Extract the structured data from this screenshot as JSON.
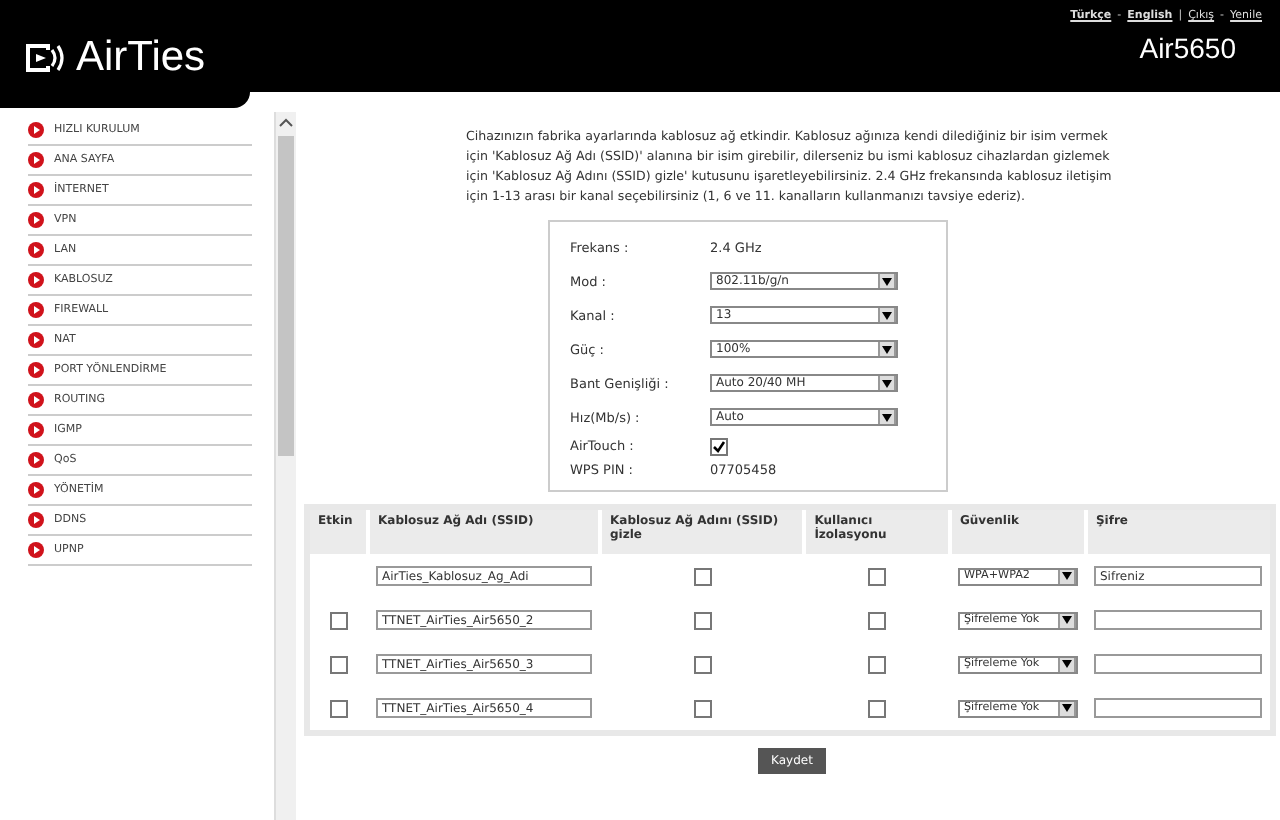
{
  "header": {
    "logo": "AirTies",
    "model": "Air5650",
    "links": [
      {
        "kind": "link",
        "label": "Türkçe",
        "bold": true
      },
      {
        "kind": "sep",
        "label": "-"
      },
      {
        "kind": "link",
        "label": "English",
        "bold": true
      },
      {
        "kind": "sep",
        "label": "|"
      },
      {
        "kind": "link",
        "label": "Çıkış",
        "bold": false
      },
      {
        "kind": "sep",
        "label": "-"
      },
      {
        "kind": "link",
        "label": "Yenile",
        "bold": false
      }
    ]
  },
  "sidebar": {
    "items": [
      "HIZLI KURULUM",
      "ANA SAYFA",
      "İNTERNET",
      "VPN",
      "LAN",
      "KABLOSUZ",
      "FIREWALL",
      "NAT",
      "PORT YÖNLENDİRME",
      "ROUTING",
      "IGMP",
      "QoS",
      "YÖNETİM",
      "DDNS",
      "UPNP"
    ]
  },
  "intro": "Cihazınızın fabrika ayarlarında kablosuz ağ etkindir. Kablosuz ağınıza kendi dilediğiniz bir isim vermek için 'Kablosuz Ağ Adı (SSID)' alanına bir isim girebilir, dilerseniz bu ismi kablosuz cihazlardan gizlemek için 'Kablosuz Ağ Adını (SSID) gizle' kutusunu işaretleyebilirsiniz. 2.4 GHz frekansında kablosuz iletişim için 1-13 arası bir kanal seçebilirsiniz (1, 6 ve 11. kanalların kullanmanızı tavsiye ederiz).",
  "settings": [
    {
      "kind": "text",
      "label": "Frekans :",
      "value": "2.4 GHz"
    },
    {
      "kind": "select",
      "label": "Mod :",
      "value": "802.11b/g/n"
    },
    {
      "kind": "select",
      "label": "Kanal :",
      "value": "13"
    },
    {
      "kind": "select",
      "label": "Güç :",
      "value": "100%"
    },
    {
      "kind": "select",
      "label": "Bant Genişliği :",
      "value": "Auto 20/40 MH"
    },
    {
      "kind": "select",
      "label": "Hız(Mb/s) :",
      "value": "Auto"
    },
    {
      "kind": "checkbox",
      "label": "AirTouch :",
      "checked": true
    },
    {
      "kind": "text",
      "label": "WPS PIN :",
      "value": "07705458"
    }
  ],
  "table": {
    "columns": [
      "Etkin",
      "Kablosuz Ağ Adı (SSID)",
      "Kablosuz Ağ Adını (SSID) gizle",
      "Kullanıcı İzolasyonu",
      "Güvenlik",
      "Şifre"
    ],
    "rows": [
      {
        "ssid": "AirTies_Kablosuz_Ag_Adi",
        "hidden": false,
        "isolation": false,
        "security": "WPA+WPA2",
        "password": "Sifreniz"
      },
      {
        "enabled": false,
        "ssid": "TTNET_AirTies_Air5650_2",
        "hidden": false,
        "isolation": false,
        "security": "Şifreleme Yok"
      },
      {
        "enabled": false,
        "ssid": "TTNET_AirTies_Air5650_3",
        "hidden": false,
        "isolation": false,
        "security": "Şifreleme Yok"
      },
      {
        "enabled": false,
        "ssid": "TTNET_AirTies_Air5650_4",
        "hidden": false,
        "isolation": false,
        "security": "Şifreleme Yok"
      }
    ]
  },
  "save_button": "Kaydet"
}
